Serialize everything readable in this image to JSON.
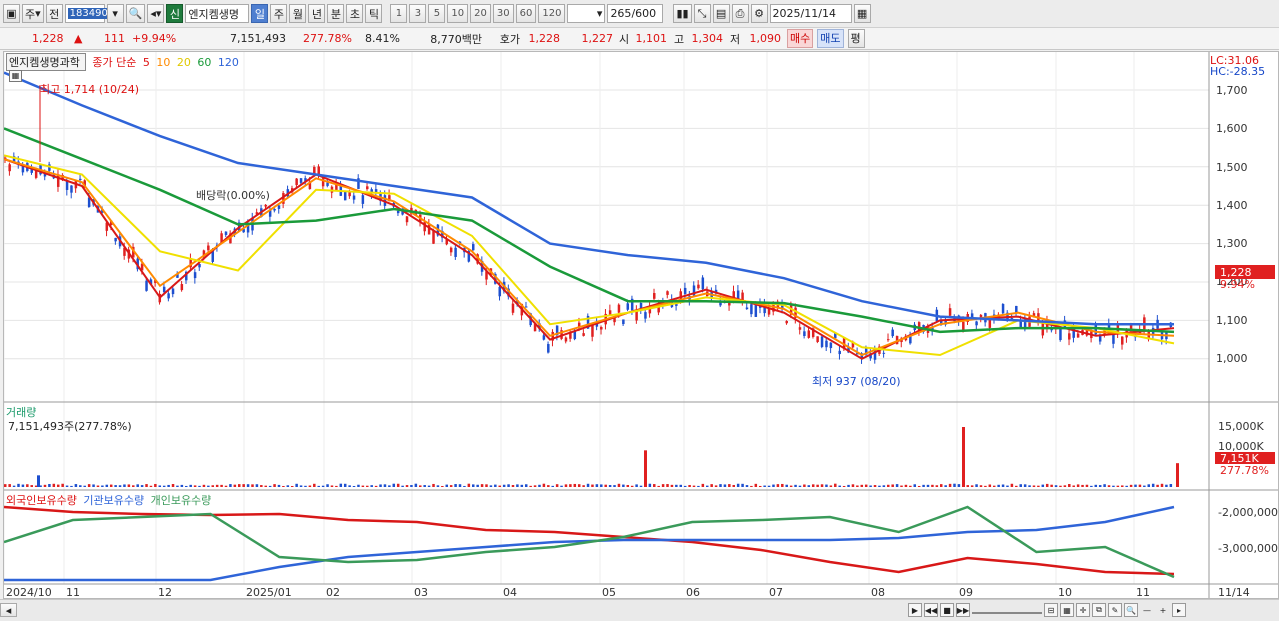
{
  "toolbar": {
    "period_selected": "주",
    "prev_label": "전",
    "stock_code": "183490",
    "new_badge": "신",
    "stock_name": "엔지켐생명",
    "timeframes": [
      "일",
      "주",
      "월",
      "년",
      "분",
      "초",
      "틱"
    ],
    "active_timeframe": "일",
    "intervals": [
      "1",
      "3",
      "5",
      "10",
      "20",
      "30",
      "60",
      "120"
    ],
    "count_value": "265",
    "count_total": "/600",
    "date_value": "2025/11/14"
  },
  "quote": {
    "price": "1,228",
    "arrow": "▲",
    "change": "111",
    "change_pct": "+9.94%",
    "volume": "7,151,493",
    "volume_ratio": "277.78%",
    "turnover_rate": "8.41%",
    "amount": "8,770백만",
    "ask_label": "호가",
    "ask1": "1,228",
    "ask2": "1,227",
    "open_label": "시",
    "open": "1,101",
    "high_label": "고",
    "high": "1,304",
    "low_label": "저",
    "low": "1,090",
    "buy_label": "매수",
    "sell_label": "매도",
    "flat_label": "평"
  },
  "price_panel": {
    "legend_name": "엔지켐생명과학",
    "legend_prefix": "종가 단순",
    "ma_periods": [
      "5",
      "10",
      "20",
      "60",
      "120"
    ],
    "lc_label": "LC:31.06",
    "hc_label": "HC:-28.35",
    "high_note": "최고 1,714 (10/24)",
    "low_note": "최저 937 (08/20)",
    "dividend_note": "배당락(0.00%)",
    "y_ticks": [
      "1,700",
      "1,600",
      "1,500",
      "1,400",
      "1,300",
      "1,200",
      "1,100",
      "1,000"
    ],
    "price_tag": "1,228",
    "pct_tag": "9.94%"
  },
  "volume_panel": {
    "title": "거래량",
    "value": "7,151,493주(277.78%)",
    "y_ticks": [
      "15,000K",
      "10,000K",
      "5,000K"
    ],
    "tag": "7,151K",
    "tag_pct": "277.78%"
  },
  "holding_panel": {
    "series": [
      "외국인보유수량",
      "기관보유수량",
      "개인보유수량"
    ],
    "y_ticks": [
      "-2,000,000",
      "-3,000,000"
    ]
  },
  "x_axis": {
    "labels": [
      "2024/10",
      "11",
      "12",
      "2025/01",
      "02",
      "03",
      "04",
      "05",
      "06",
      "07",
      "08",
      "09",
      "10",
      "11"
    ],
    "end_label": "11/14"
  },
  "colors": {
    "ma5": "#d81818",
    "ma10": "#ff8a00",
    "ma20": "#f0e000",
    "ma60": "#1a9a3a",
    "ma120": "#2f64d8",
    "up": "#e02020",
    "down": "#1d4fcf",
    "foreign": "#d81818",
    "institution": "#2f64d8",
    "individual": "#3a9a5a"
  },
  "chart_data": {
    "type": "line",
    "y_range_price": [
      937,
      1714
    ],
    "x_range": [
      "2024/10",
      "2025/11/14"
    ],
    "series": [
      {
        "name": "5",
        "values_by_month": [
          1520,
          1450,
          1160,
          1340,
          1480,
          1400,
          1270,
          1050,
          1120,
          1180,
          1120,
          1000,
          1100,
          1110,
          1060,
          1080
        ]
      },
      {
        "name": "10",
        "values_by_month": [
          1520,
          1460,
          1190,
          1330,
          1470,
          1410,
          1280,
          1060,
          1120,
          1170,
          1130,
          1010,
          1090,
          1120,
          1070,
          1060
        ]
      },
      {
        "name": "20",
        "values_by_month": [
          1530,
          1480,
          1280,
          1230,
          1440,
          1430,
          1320,
          1090,
          1120,
          1160,
          1140,
          1030,
          1010,
          1100,
          1080,
          1040
        ]
      },
      {
        "name": "60",
        "values_by_month": [
          1600,
          1520,
          1440,
          1350,
          1360,
          1390,
          1360,
          1240,
          1150,
          1150,
          1145,
          1110,
          1070,
          1080,
          1080,
          1070
        ]
      },
      {
        "name": "120",
        "values_by_month": [
          1745,
          1660,
          1580,
          1510,
          1480,
          1450,
          1420,
          1300,
          1270,
          1250,
          1210,
          1150,
          1110,
          1100,
          1090,
          1090
        ]
      }
    ],
    "volume_highlights": [
      {
        "date": "2024/10/24",
        "value_k": 3500
      },
      {
        "date": "2025/05",
        "value_k": 11000
      },
      {
        "date": "2025/09",
        "value_k": 18000
      },
      {
        "date": "2025/11/14",
        "value_k": 7151
      }
    ]
  }
}
